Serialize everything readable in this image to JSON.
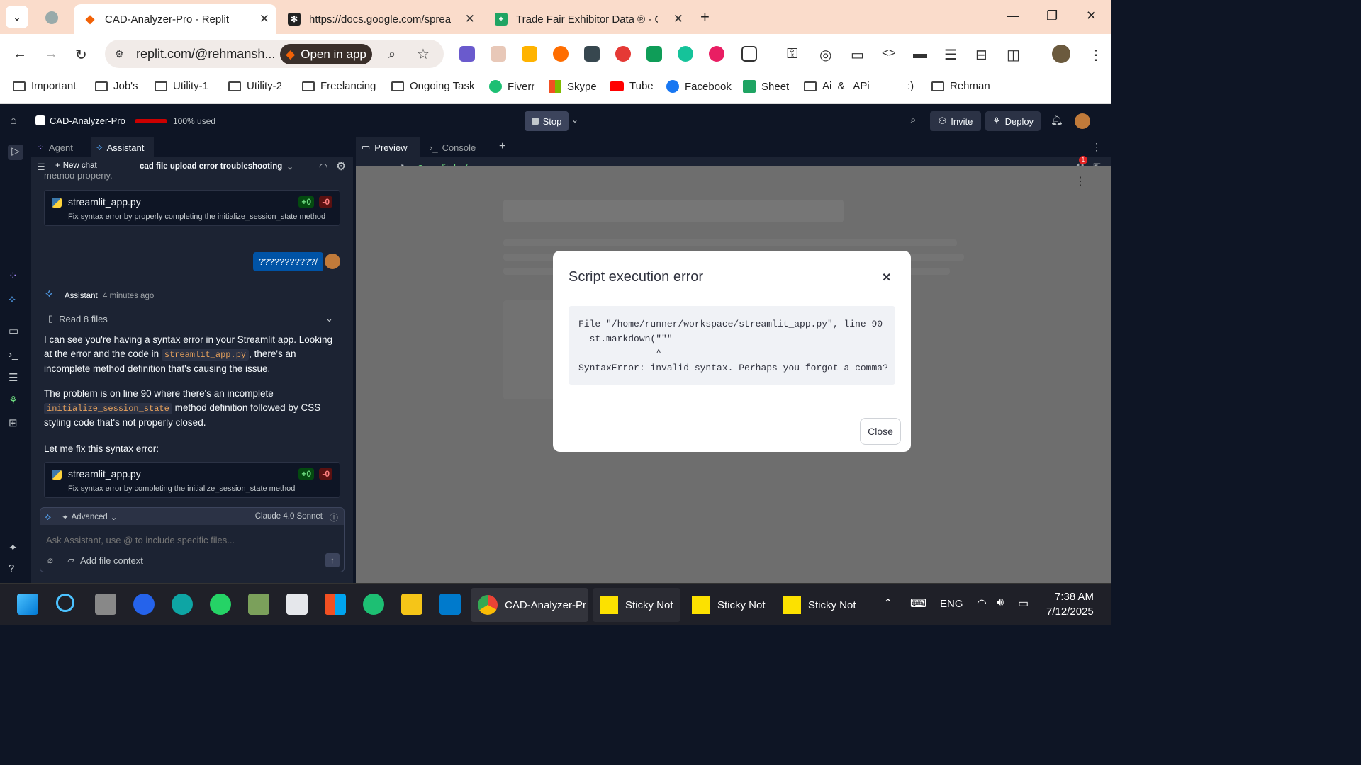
{
  "browser": {
    "tabs": [
      {
        "title": "CAD-Analyzer-Pro - Replit",
        "active": true
      },
      {
        "title": "https://docs.google.com/spreac",
        "active": false
      },
      {
        "title": "Trade Fair Exhibitor Data ® - Gc",
        "active": false
      }
    ],
    "url": "replit.com/@rehmansh...",
    "open_in_app": "Open in app",
    "bookmarks": [
      "Important",
      "Job's",
      "Utility-1",
      "Utility-2",
      "Freelancing",
      "Ongoing Task",
      "Fiverr",
      "Skype",
      "Tube",
      "Facebook",
      "Sheet",
      "Ai  &   APi",
      ":)",
      "Rehman"
    ]
  },
  "replit": {
    "project_name": "CAD-Analyzer-Pro",
    "usage": "100% used",
    "stop_label": "Stop",
    "invite_label": "Invite",
    "deploy_label": "Deploy",
    "left_tabs": [
      "Agent",
      "Assistant"
    ],
    "new_chat": "New chat",
    "chat_title": "cad file upload error troubleshooting",
    "truncated_prev": "method properly.",
    "card1": {
      "file": "streamlit_app.py",
      "plus": "+0",
      "minus": "-0",
      "desc": "Fix syntax error by properly completing the initialize_session_state method"
    },
    "user_message": "???????????/",
    "assistant_name": "Assistant",
    "assistant_time": "4 minutes ago",
    "read_files": "Read 8 files",
    "p1_a": "I can see you're having a syntax error in your Streamlit app. Looking at the error and the code in",
    "p1_code": "streamlit_app.py",
    "p1_b": ", there's an incomplete method definition that's causing the issue.",
    "p2_a": "The problem is on line 90 where there's an incomplete",
    "p2_code": "initialize_session_state",
    "p2_b": "method definition followed by CSS styling code that's not properly closed.",
    "p3": "Let me fix this syntax error:",
    "card2": {
      "file": "streamlit_app.py",
      "plus": "+0",
      "minus": "-0",
      "desc": "Fix syntax error by completing the initialize_session_state method"
    },
    "advanced": "Advanced",
    "model": "Claude 4.0 Sonnet",
    "input_placeholder": "Ask Assistant, use @ to include specific files...",
    "add_file_context": "Add file context",
    "right_tabs": [
      "Preview",
      "Console"
    ],
    "preview_url": ".replit.dev/",
    "notif_count": "1"
  },
  "modal": {
    "title": "Script execution error",
    "code": "File \"/home/runner/workspace/streamlit_app.py\", line 90\n  st.markdown(\"\"\"\n              ^\nSyntaxError: invalid syntax. Perhaps you forgot a comma?",
    "close_label": "Close"
  },
  "taskbar": {
    "apps": [
      "CAD-Analyzer-Pr",
      "Sticky Not",
      "Sticky Not",
      "Sticky Not"
    ],
    "lang": "ENG",
    "time": "7:38 AM",
    "date": "7/12/2025"
  },
  "colors": {
    "replit_bg": "#0e1525",
    "panel": "#1c2333",
    "accent": "#0053a6",
    "tab_bar": "#fadccb"
  }
}
